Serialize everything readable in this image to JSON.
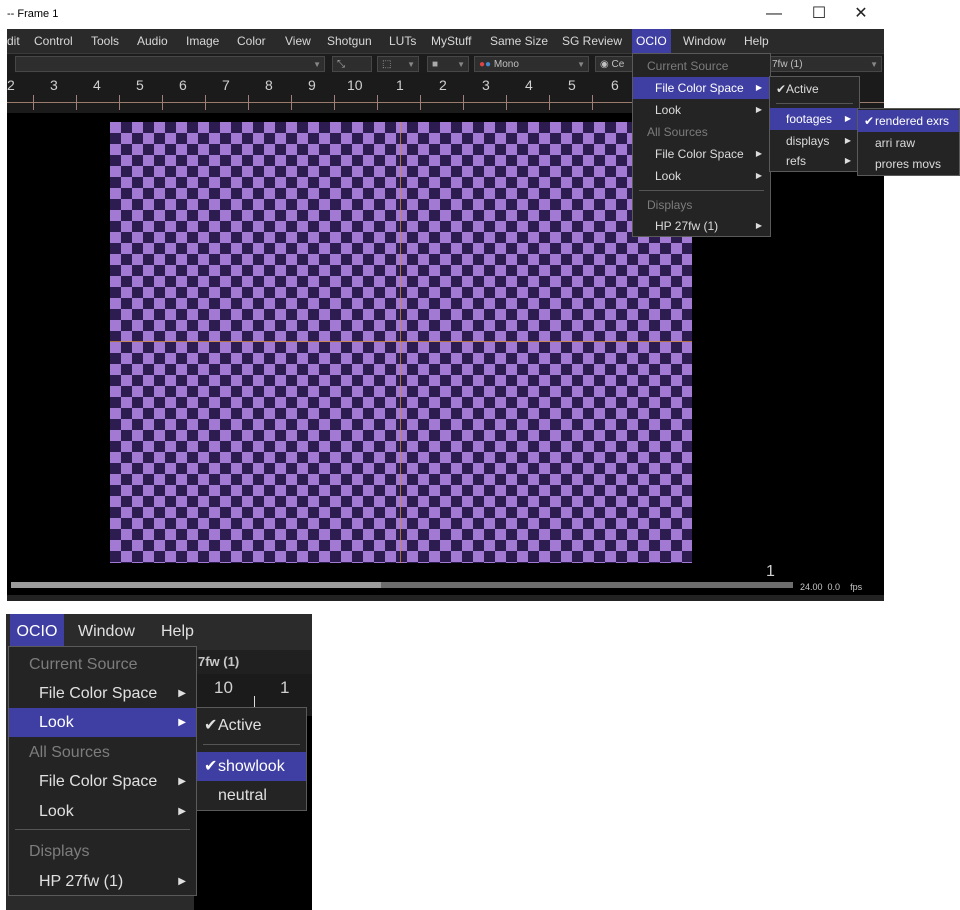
{
  "window": {
    "title": "-- Frame 1",
    "controls": {
      "minimize": "—",
      "maximize": "☐",
      "close": "✕"
    }
  },
  "menubar": [
    "dit",
    "Control",
    "Tools",
    "Audio",
    "Image",
    "Color",
    "View",
    "Shotgun",
    "LUTs",
    "MyStuff",
    "Same Size",
    "SG Review",
    "OCIO",
    "Window",
    "Help"
  ],
  "toolbar": {
    "mono": "Mono",
    "ce": "Ce",
    "display": "7fw (1)"
  },
  "ruler": {
    "numbers": [
      "2",
      "3",
      "4",
      "5",
      "6",
      "7",
      "8",
      "9",
      "10",
      "1",
      "2",
      "3",
      "4",
      "5",
      "6"
    ]
  },
  "playback": {
    "frame": "1",
    "fps_value": "24.00",
    "offset": "0.0",
    "fps_label": "fps"
  },
  "ocio_menu": {
    "items": [
      {
        "label": "Current Source",
        "type": "header"
      },
      {
        "label": "File Color Space",
        "submenu": true,
        "highlighted": true
      },
      {
        "label": "Look",
        "submenu": true
      },
      {
        "label": "All Sources",
        "type": "header"
      },
      {
        "label": "File Color Space",
        "submenu": true
      },
      {
        "label": "Look",
        "submenu": true
      },
      {
        "label": "Displays",
        "type": "header"
      },
      {
        "label": "HP 27fw (1)",
        "submenu": true
      }
    ]
  },
  "file_color_space_submenu": {
    "active": "Active",
    "items": [
      {
        "label": "footages",
        "highlighted": true
      },
      {
        "label": "displays"
      },
      {
        "label": "refs"
      }
    ]
  },
  "footages_submenu": {
    "items": [
      {
        "label": "rendered exrs",
        "checked": true,
        "highlighted": true
      },
      {
        "label": "arri raw"
      },
      {
        "label": "prores movs"
      }
    ]
  },
  "zoom": {
    "menubar": [
      "OCIO",
      "Window",
      "Help"
    ],
    "toolbar_text": "7fw (1)",
    "ruler": [
      "10",
      "1"
    ],
    "ocio_items": [
      {
        "label": "Current Source",
        "type": "header"
      },
      {
        "label": "File Color Space",
        "submenu": true
      },
      {
        "label": "Look",
        "submenu": true,
        "highlighted": true
      },
      {
        "label": "All Sources",
        "type": "header"
      },
      {
        "label": "File Color Space",
        "submenu": true
      },
      {
        "label": "Look",
        "submenu": true
      },
      {
        "label": "Displays",
        "type": "header"
      },
      {
        "label": "HP 27fw (1)",
        "submenu": true
      }
    ],
    "look_submenu": {
      "active": "Active",
      "items": [
        {
          "label": "showlook",
          "checked": true,
          "highlighted": true
        },
        {
          "label": "neutral"
        }
      ]
    }
  },
  "colors": {
    "highlight": "#3f3fa3",
    "check_light": "#a27ad3",
    "check_dark": "#2c1c4f"
  }
}
